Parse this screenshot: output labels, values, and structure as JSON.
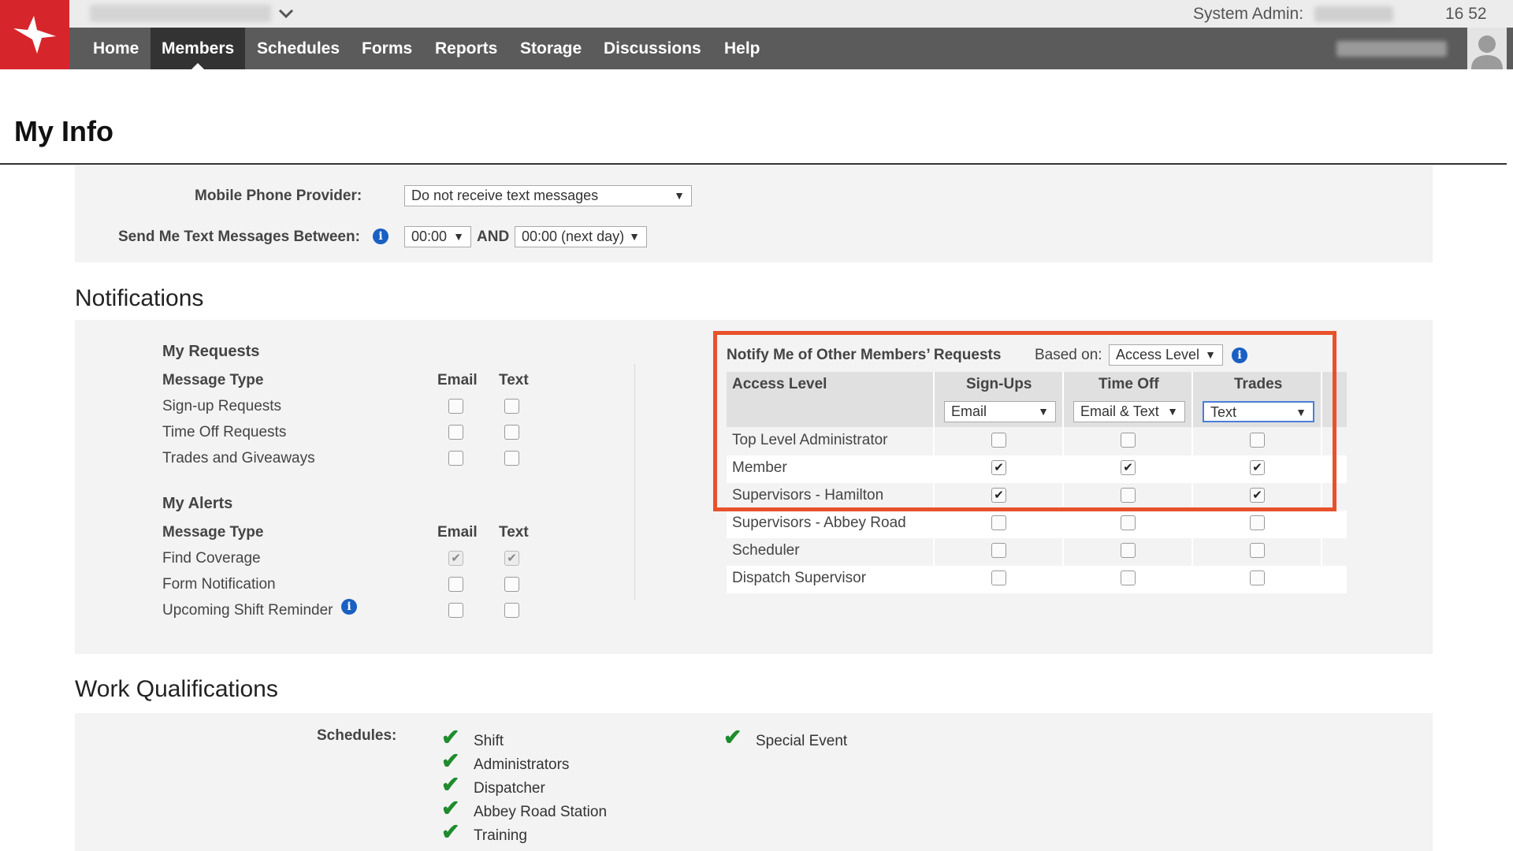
{
  "header": {
    "system_admin_label": "System Admin:",
    "clock": "16 52",
    "chevron_icon": "chevron-down-icon",
    "logo_icon": "bird-logo-icon",
    "avatar_icon": "user-avatar-icon"
  },
  "nav": {
    "items": [
      {
        "label": "Home"
      },
      {
        "label": "Members"
      },
      {
        "label": "Schedules"
      },
      {
        "label": "Forms"
      },
      {
        "label": "Reports"
      },
      {
        "label": "Storage"
      },
      {
        "label": "Discussions"
      },
      {
        "label": "Help"
      }
    ],
    "active": "Members"
  },
  "page": {
    "title": "My Info"
  },
  "contact": {
    "provider_label": "Mobile Phone Provider:",
    "provider_value": "Do not receive text messages",
    "between_label": "Send Me Text Messages Between:",
    "from_value": "00:00",
    "and_label": "AND",
    "to_value": "00:00 (next day)"
  },
  "notifications": {
    "title": "Notifications",
    "my_requests": {
      "title": "My Requests",
      "col_type": "Message Type",
      "col_email": "Email",
      "col_text": "Text",
      "rows": [
        {
          "label": "Sign-up Requests",
          "email": false,
          "text": false
        },
        {
          "label": "Time Off Requests",
          "email": false,
          "text": false
        },
        {
          "label": "Trades and Giveaways",
          "email": false,
          "text": false
        }
      ]
    },
    "my_alerts": {
      "title": "My Alerts",
      "col_type": "Message Type",
      "col_email": "Email",
      "col_text": "Text",
      "rows": [
        {
          "label": "Find Coverage",
          "email": true,
          "text": true,
          "disabled": true
        },
        {
          "label": "Form Notification",
          "email": false,
          "text": false
        },
        {
          "label": "Upcoming Shift Reminder",
          "email": false,
          "text": false
        }
      ]
    },
    "others": {
      "title": "Notify Me of Other Members’ Requests",
      "based_on_label": "Based on:",
      "based_on_value": "Access Level",
      "col_access": "Access Level",
      "col_signups": "Sign-Ups",
      "col_timeoff": "Time Off",
      "col_trades": "Trades",
      "signups_method": "Email",
      "timeoff_method": "Email & Text",
      "trades_method": "Text",
      "rows": [
        {
          "label": "Top Level Administrator",
          "signups": false,
          "timeoff": false,
          "trades": false
        },
        {
          "label": "Member",
          "signups": true,
          "timeoff": true,
          "trades": true
        },
        {
          "label": "Supervisors - Hamilton",
          "signups": true,
          "timeoff": false,
          "trades": true
        },
        {
          "label": "Supervisors - Abbey Road",
          "signups": false,
          "timeoff": false,
          "trades": false
        },
        {
          "label": "Scheduler",
          "signups": false,
          "timeoff": false,
          "trades": false
        },
        {
          "label": "Dispatch Supervisor",
          "signups": false,
          "timeoff": false,
          "trades": false
        }
      ]
    }
  },
  "work_qualifications": {
    "title": "Work Qualifications",
    "schedules_label": "Schedules:",
    "col1": [
      "Shift",
      "Administrators",
      "Dispatcher",
      "Abbey Road Station",
      "Training"
    ],
    "col2": [
      "Special Event"
    ]
  },
  "colors": {
    "brand_red": "#d6262b",
    "nav_bg": "#5b5b5b",
    "highlight_orange": "#e8522b",
    "check_green": "#1e8c2c",
    "info_blue": "#1a5fc2"
  }
}
